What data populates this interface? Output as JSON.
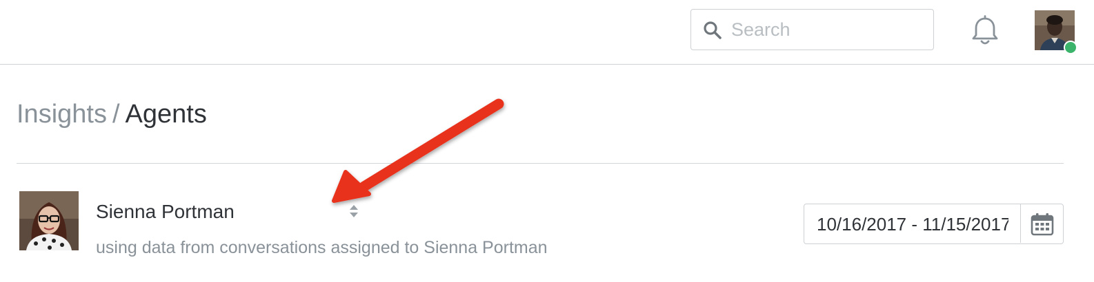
{
  "header": {
    "search": {
      "placeholder": "Search",
      "value": ""
    },
    "icons": {
      "search": "search-icon",
      "notifications": "bell-icon"
    },
    "user_status_color": "#3bb36a"
  },
  "breadcrumb": {
    "parent": "Insights",
    "separator": "/",
    "current": "Agents"
  },
  "agent": {
    "name": "Sienna Portman",
    "subtitle": "using data from conversations assigned to Sienna Portman"
  },
  "date_range": {
    "value": "10/16/2017 - 11/15/2017",
    "icon": "calendar-icon"
  },
  "colors": {
    "annotation_arrow": "#e8321f",
    "muted_text": "#8a9299",
    "primary_text": "#2f3337"
  }
}
